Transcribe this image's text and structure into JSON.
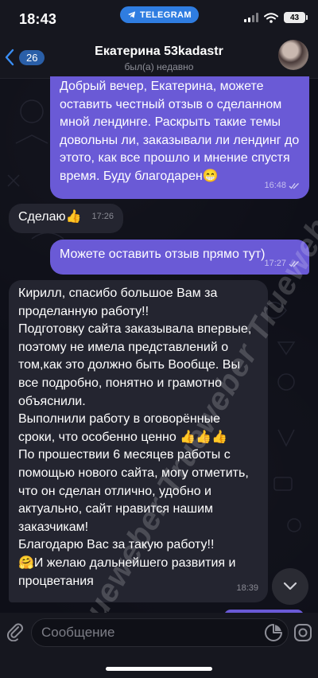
{
  "status_bar": {
    "time": "18:43",
    "telegram_label": "TELEGRAM",
    "battery": "43"
  },
  "header": {
    "back_count": "26",
    "name": "Екатерина 53kadastr",
    "status": "был(а) недавно"
  },
  "messages": [
    {
      "direction": "out",
      "text": "Добрый вечер, Екатерина, можете оставить честный отзыв о сделанном мной лендинге. Раскрыть такие темы довольны ли, заказывали ли лендинг до этото, как все прошло и мнение спустя время. Буду благодарен😁",
      "time": "16:48",
      "read": true
    },
    {
      "direction": "in",
      "text": "Сделаю👍",
      "time": "17:26"
    },
    {
      "direction": "out",
      "text": "Можете оставить отзыв прямо тут)",
      "time": "17:27",
      "read": true
    },
    {
      "direction": "in",
      "text": "Кирилл, спасибо большое Вам за проделанную работу!!\nПодготовку сайта заказывала впервые, поэтому не имела представлений о том,как это должно быть Вообще. Вы все подробно, понятно и грамотно объяснили.\nВыполнили работу в оговорённые сроки, что особенно ценно 👍👍👍\nПо прошествии 6 месяцев работы с помощью нового сайта, могу отметить, что он сделан отлично, удобно и актуально, сайт нравится нашим заказчикам!\nБлагодарю Вас за такую работу!!\n🤗И желаю дальнейшего развития и процветания",
      "time": "18:39"
    }
  ],
  "input": {
    "placeholder": "Сообщение"
  },
  "watermark": "Trueweber Trueweber Trueweber",
  "colors": {
    "outgoing_bubble": "#6a5ad6",
    "incoming_bubble": "#242530",
    "background": "#0e0f18",
    "accent": "#2f7de1"
  }
}
